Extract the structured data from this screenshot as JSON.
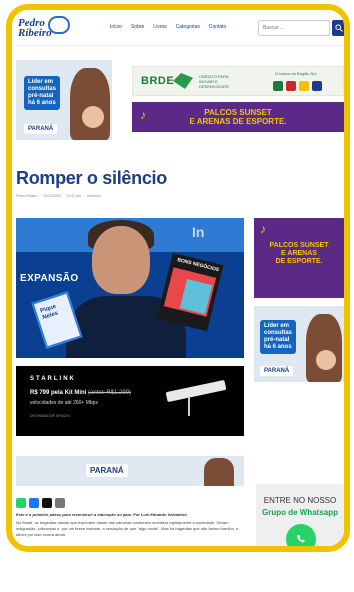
{
  "header": {
    "logo_line1": "Pedro",
    "logo_line2": "Ribeiro",
    "nav": [
      "Início",
      "Sobre",
      "Livros",
      "Categorias",
      "Contato"
    ],
    "search_placeholder": "Buscar ..."
  },
  "ads": {
    "parana_left": {
      "text_lines": [
        "Líder em",
        "consultas",
        "pré-natal",
        "há 6 anos"
      ],
      "logo": "PARANÁ"
    },
    "brde": {
      "name": "BRDE",
      "tagline": "CRÉDITO PARA INOVAR E DESENVOLVER",
      "top_right": "O banco da Região Sul"
    },
    "palcos": {
      "line1": "PALCOS SUNSET",
      "line2": "E ARENAS DE ESPORTE."
    },
    "palcos_side": {
      "line1": "PALCOS SUNSET",
      "line2": "E ARENAS",
      "line3": "DE ESPORTE."
    },
    "parana_side": {
      "text_lines": [
        "Líder em",
        "consultas",
        "pré-natal",
        "há 6 anos"
      ],
      "logo": "PARANÁ"
    },
    "starlink": {
      "brand": "STARLINK",
      "offer_prefix": "R$ 799 pela Kit Mini",
      "offer_strike": "(antes R$1.299)",
      "sub": "velocidades de até 260+ Mbps",
      "partner": "DISTRIBUIDOR SPACEX"
    },
    "parana_wide": {
      "logo": "PARANÁ"
    },
    "whatsapp": {
      "line1": "ENTRE NO NOSSO",
      "line2": "Grupo de Whatsapp"
    }
  },
  "article": {
    "title": "Romper o silêncio",
    "meta": [
      "Pedro Ribeiro",
      "22/11/2025",
      "10:17 am",
      "Nenhum"
    ],
    "hero_text": "EXPANSÃO",
    "hero_book_left": "Pique Neles",
    "hero_book_right": "BONS NEGÓCIOS",
    "lead": "Este é o primeiro passo para reconstruir a educação no país. Por Luís Eduardo Salvadore.",
    "body": "No Brasil, as tragédias diárias que explodem diante das câmeras costumam mobilizar rapidamente a sociedade. Geram indignação, cobranças e, por um breve instante, a sensação de que \"algo muda\". Mas há tragédias que não fazem barulho, e talvez por isso ocorra ainda"
  },
  "colors": {
    "brand_blue": "#1b3e8a",
    "accent_yellow": "#f2c200",
    "purple": "#5b2a86",
    "whatsapp_green": "#25d366"
  }
}
